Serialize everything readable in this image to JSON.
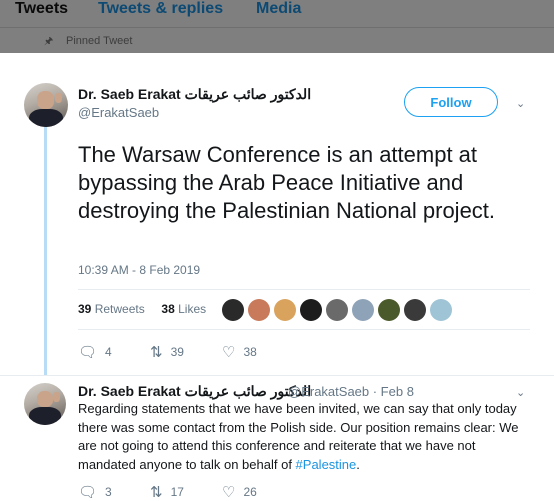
{
  "background": {
    "tabs": [
      "Tweets",
      "Tweets & replies",
      "Media"
    ],
    "pinned_label": "Pinned Tweet"
  },
  "main_tweet": {
    "display_name": "Dr. Saeb Erakat الدكتور صائب عريقات",
    "handle": "@ErakatSaeb",
    "follow_label": "Follow",
    "text": "The Warsaw Conference is an attempt at bypassing the Arab Peace Initiative and destroying the Palestinian National project.",
    "timestamp": "10:39 AM - 8 Feb 2019",
    "retweets_count": "39",
    "retweets_label": "Retweets",
    "likes_count": "38",
    "likes_label": "Likes",
    "actions": {
      "replies": "4",
      "retweets": "39",
      "likes": "38"
    }
  },
  "reply_tweet": {
    "display_name": "Dr. Saeb Erakat الدكتور صائب عريقات",
    "handle_date": "@ErakatSaeb · Feb 8",
    "text": "Regarding statements that we have been invited, we can say that only today there was some contact from the Polish side. Our position remains clear: We are not going to attend this conference and reiterate that we have not mandated anyone to talk on behalf of ",
    "hashtag": "#Palestine",
    "text_end": ".",
    "actions": {
      "replies": "3",
      "retweets": "17",
      "likes": "26"
    }
  },
  "icons": {
    "reply": "speech-bubble-icon",
    "retweet": "retweet-icon",
    "like": "heart-icon",
    "pin": "pin-icon",
    "menu": "chevron-down-icon"
  },
  "colors": {
    "accent": "#1da1f2",
    "thread_line": "#b8dcf5",
    "muted_text": "#657786",
    "dim_overlay": "#7f7f7f"
  }
}
